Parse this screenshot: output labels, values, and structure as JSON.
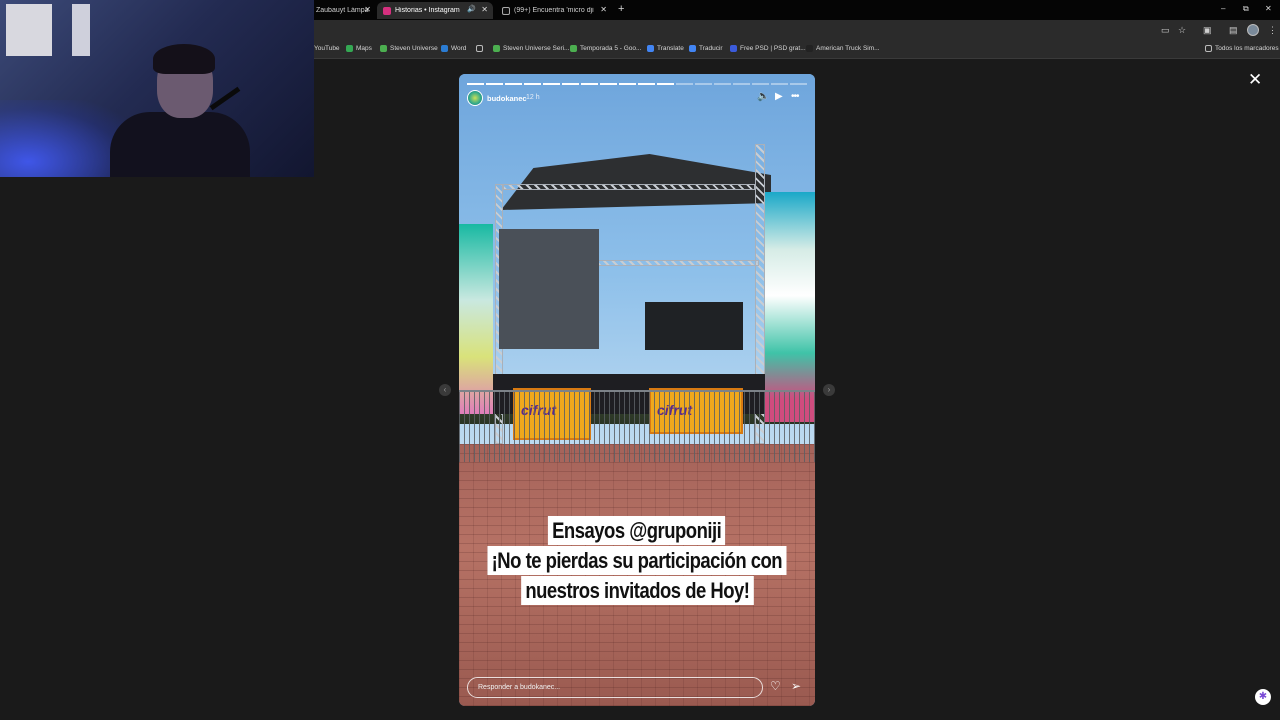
{
  "browser": {
    "tabs": [
      {
        "title": "Zaubauyt Lámpa",
        "active": false,
        "favicon_color": "#c8a25a"
      },
      {
        "title": "Historias • Instagram",
        "active": true,
        "favicon_color": "#d6307f"
      },
      {
        "title": "(99+) Encuentra 'micro dji mic m",
        "active": false,
        "favicon_color": "#111111"
      }
    ],
    "new_tab": "+",
    "window_controls": {
      "minimize": "–",
      "restore": "⧉",
      "close": "✕"
    },
    "toolbar_icons": [
      "cast-icon",
      "star-icon",
      "extensions-icon",
      "sidepanel-icon",
      "profile-avatar",
      "menu-icon"
    ],
    "bookmarks": [
      {
        "label": "YouTube",
        "color": "#e33"
      },
      {
        "label": "Maps",
        "color": "#34a853"
      },
      {
        "label": "Steven Universe",
        "color": "#4caf50"
      },
      {
        "label": "Word",
        "color": "#2b7cd3"
      },
      {
        "label": "",
        "color": "#888",
        "folder": true
      },
      {
        "label": "Steven Universe Seri...",
        "color": "#4caf50"
      },
      {
        "label": "Temporada 5 - Goo...",
        "color": "#4caf50"
      },
      {
        "label": "Translate",
        "color": "#4285f4"
      },
      {
        "label": "Traducir",
        "color": "#4285f4"
      },
      {
        "label": "Free PSD | PSD grat...",
        "color": "#3b5bdb"
      },
      {
        "label": "American Truck Sim...",
        "color": "#222"
      }
    ],
    "all_bookmarks": "Todos los marcadores"
  },
  "story": {
    "username": "budokanec",
    "time_ago": "12 h",
    "segments_total": 18,
    "segments_done": 11,
    "caption_lines": [
      "Ensayos @gruponiji",
      "¡No te pierdas su participación con",
      "nuestros invitados de Hoy!"
    ],
    "reply_placeholder": "Responder a budokanec...",
    "banner_text": "cifrut"
  },
  "colors": {
    "page_bg": "#1a1a1a",
    "story_sky": "#8ec0ea",
    "caption_bg": "#ffffff"
  }
}
